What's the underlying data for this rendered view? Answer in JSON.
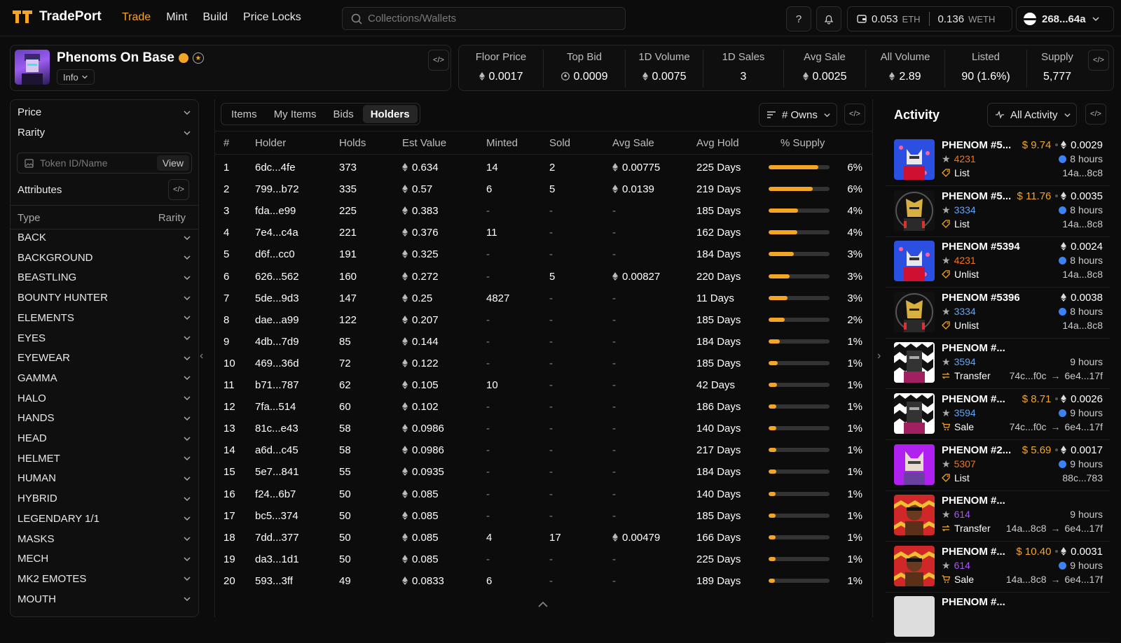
{
  "header": {
    "brand": "TradePort",
    "nav": [
      "Trade",
      "Mint",
      "Build",
      "Price Locks"
    ],
    "search_placeholder": "Collections/Wallets",
    "help": "?",
    "wallet_eth": "0.053",
    "wallet_eth_unit": "ETH",
    "wallet_weth": "0.136",
    "wallet_weth_unit": "WETH",
    "account": "268...64a"
  },
  "collection": {
    "name": "Phenoms On Base",
    "info_label": "Info"
  },
  "stats": [
    {
      "label": "Floor Price",
      "value": "0.0017",
      "eth": true
    },
    {
      "label": "Top Bid",
      "value": "0.0009",
      "eth": true
    },
    {
      "label": "1D Volume",
      "value": "0.0075",
      "eth": true
    },
    {
      "label": "1D Sales",
      "value": "3",
      "eth": false
    },
    {
      "label": "Avg Sale",
      "value": "0.0025",
      "eth": true
    },
    {
      "label": "All Volume",
      "value": "2.89",
      "eth": true
    },
    {
      "label": "Listed",
      "value": "90 (1.6%)",
      "eth": false
    },
    {
      "label": "Supply",
      "value": "5,777",
      "eth": false
    }
  ],
  "filters": {
    "price_label": "Price",
    "rarity_label": "Rarity",
    "token_placeholder": "Token ID/Name",
    "view_label": "View",
    "attributes_label": "Attributes",
    "type_header": "Type",
    "rarity_header": "Rarity",
    "attributes": [
      "BACK",
      "BACKGROUND",
      "BEASTLING",
      "BOUNTY HUNTER",
      "ELEMENTS",
      "EYES",
      "EYEWEAR",
      "GAMMA",
      "HALO",
      "HANDS",
      "HEAD",
      "HELMET",
      "HUMAN",
      "HYBRID",
      "LEGENDARY 1/1",
      "MASKS",
      "MECH",
      "MK2 EMOTES",
      "MOUTH"
    ]
  },
  "tabs": [
    "Items",
    "My Items",
    "Bids",
    "Holders"
  ],
  "sort_label": "# Owns",
  "table": {
    "headers": [
      "#",
      "Holder",
      "Holds",
      "Est Value",
      "Minted",
      "Sold",
      "Avg Sale",
      "Avg Hold",
      "% Supply"
    ],
    "rows": [
      {
        "n": "1",
        "holder": "6dc...4fe",
        "holds": "373",
        "est": "0.634",
        "minted": "14",
        "sold": "2",
        "avg": "0.00775",
        "hold": "225 Days",
        "pct": "6%",
        "fill": 0.065
      },
      {
        "n": "2",
        "holder": "799...b72",
        "holds": "335",
        "est": "0.57",
        "minted": "6",
        "sold": "5",
        "avg": "0.0139",
        "hold": "219 Days",
        "pct": "6%",
        "fill": 0.058
      },
      {
        "n": "3",
        "holder": "fda...e99",
        "holds": "225",
        "est": "0.383",
        "minted": "-",
        "sold": "-",
        "avg": "-",
        "hold": "185 Days",
        "pct": "4%",
        "fill": 0.039
      },
      {
        "n": "4",
        "holder": "7e4...c4a",
        "holds": "221",
        "est": "0.376",
        "minted": "11",
        "sold": "-",
        "avg": "-",
        "hold": "162 Days",
        "pct": "4%",
        "fill": 0.038
      },
      {
        "n": "5",
        "holder": "d6f...cc0",
        "holds": "191",
        "est": "0.325",
        "minted": "-",
        "sold": "-",
        "avg": "-",
        "hold": "184 Days",
        "pct": "3%",
        "fill": 0.033
      },
      {
        "n": "6",
        "holder": "626...562",
        "holds": "160",
        "est": "0.272",
        "minted": "-",
        "sold": "5",
        "avg": "0.00827",
        "hold": "220 Days",
        "pct": "3%",
        "fill": 0.028
      },
      {
        "n": "7",
        "holder": "5de...9d3",
        "holds": "147",
        "est": "0.25",
        "minted": "4827",
        "sold": "-",
        "avg": "-",
        "hold": "11 Days",
        "pct": "3%",
        "fill": 0.025
      },
      {
        "n": "8",
        "holder": "dae...a99",
        "holds": "122",
        "est": "0.207",
        "minted": "-",
        "sold": "-",
        "avg": "-",
        "hold": "185 Days",
        "pct": "2%",
        "fill": 0.021
      },
      {
        "n": "9",
        "holder": "4db...7d9",
        "holds": "85",
        "est": "0.144",
        "minted": "-",
        "sold": "-",
        "avg": "-",
        "hold": "184 Days",
        "pct": "1%",
        "fill": 0.015
      },
      {
        "n": "10",
        "holder": "469...36d",
        "holds": "72",
        "est": "0.122",
        "minted": "-",
        "sold": "-",
        "avg": "-",
        "hold": "185 Days",
        "pct": "1%",
        "fill": 0.012
      },
      {
        "n": "11",
        "holder": "b71...787",
        "holds": "62",
        "est": "0.105",
        "minted": "10",
        "sold": "-",
        "avg": "-",
        "hold": "42 Days",
        "pct": "1%",
        "fill": 0.011
      },
      {
        "n": "12",
        "holder": "7fa...514",
        "holds": "60",
        "est": "0.102",
        "minted": "-",
        "sold": "-",
        "avg": "-",
        "hold": "186 Days",
        "pct": "1%",
        "fill": 0.01
      },
      {
        "n": "13",
        "holder": "81c...e43",
        "holds": "58",
        "est": "0.0986",
        "minted": "-",
        "sold": "-",
        "avg": "-",
        "hold": "140 Days",
        "pct": "1%",
        "fill": 0.01
      },
      {
        "n": "14",
        "holder": "a6d...c45",
        "holds": "58",
        "est": "0.0986",
        "minted": "-",
        "sold": "-",
        "avg": "-",
        "hold": "217 Days",
        "pct": "1%",
        "fill": 0.01
      },
      {
        "n": "15",
        "holder": "5e7...841",
        "holds": "55",
        "est": "0.0935",
        "minted": "-",
        "sold": "-",
        "avg": "-",
        "hold": "184 Days",
        "pct": "1%",
        "fill": 0.01
      },
      {
        "n": "16",
        "holder": "f24...6b7",
        "holds": "50",
        "est": "0.085",
        "minted": "-",
        "sold": "-",
        "avg": "-",
        "hold": "140 Days",
        "pct": "1%",
        "fill": 0.009
      },
      {
        "n": "17",
        "holder": "bc5...374",
        "holds": "50",
        "est": "0.085",
        "minted": "-",
        "sold": "-",
        "avg": "-",
        "hold": "185 Days",
        "pct": "1%",
        "fill": 0.009
      },
      {
        "n": "18",
        "holder": "7dd...377",
        "holds": "50",
        "est": "0.085",
        "minted": "4",
        "sold": "17",
        "avg": "0.00479",
        "hold": "166 Days",
        "pct": "1%",
        "fill": 0.009
      },
      {
        "n": "19",
        "holder": "da3...1d1",
        "holds": "50",
        "est": "0.085",
        "minted": "-",
        "sold": "-",
        "avg": "-",
        "hold": "225 Days",
        "pct": "1%",
        "fill": 0.009
      },
      {
        "n": "20",
        "holder": "593...3ff",
        "holds": "49",
        "est": "0.0833",
        "minted": "6",
        "sold": "-",
        "avg": "-",
        "hold": "189 Days",
        "pct": "1%",
        "fill": 0.008
      }
    ]
  },
  "activity": {
    "title": "Activity",
    "filter_label": "All Activity",
    "items": [
      {
        "name": "PHENOM #5...",
        "usd": "$ 9.74",
        "eth": "0.0029",
        "rank": "4231",
        "rank_color": "#f97316",
        "time": "8 hours",
        "time_icon": true,
        "type": "List",
        "type_icon": "tag",
        "addr_from": "14a...8c8",
        "addr_to": "",
        "thumb": "wolf-blue"
      },
      {
        "name": "PHENOM #5...",
        "usd": "$ 11.76",
        "eth": "0.0035",
        "rank": "3334",
        "rank_color": "#60a5fa",
        "time": "8 hours",
        "time_icon": true,
        "type": "List",
        "type_icon": "tag",
        "addr_from": "14a...8c8",
        "addr_to": "",
        "thumb": "gold-helmet"
      },
      {
        "name": "PHENOM #5394",
        "usd": "",
        "eth": "0.0024",
        "rank": "4231",
        "rank_color": "#f97316",
        "time": "8 hours",
        "time_icon": true,
        "type": "Unlist",
        "type_icon": "tag",
        "addr_from": "14a...8c8",
        "addr_to": "",
        "thumb": "wolf-blue"
      },
      {
        "name": "PHENOM #5396",
        "usd": "",
        "eth": "0.0038",
        "rank": "3334",
        "rank_color": "#60a5fa",
        "time": "8 hours",
        "time_icon": true,
        "type": "Unlist",
        "type_icon": "tag",
        "addr_from": "14a...8c8",
        "addr_to": "",
        "thumb": "gold-helmet"
      },
      {
        "name": "PHENOM #...",
        "usd": "",
        "eth": "",
        "rank": "3594",
        "rank_color": "#60a5fa",
        "time": "9 hours",
        "time_icon": false,
        "type": "Transfer",
        "type_icon": "transfer",
        "addr_from": "74c...f0c",
        "addr_to": "6e4...17f",
        "thumb": "zigzag"
      },
      {
        "name": "PHENOM #...",
        "usd": "$ 8.71",
        "eth": "0.0026",
        "rank": "3594",
        "rank_color": "#60a5fa",
        "time": "9 hours",
        "time_icon": true,
        "type": "Sale",
        "type_icon": "cart",
        "addr_from": "74c...f0c",
        "addr_to": "6e4...17f",
        "thumb": "zigzag"
      },
      {
        "name": "PHENOM #2...",
        "usd": "$ 5.69",
        "eth": "0.0017",
        "rank": "5307",
        "rank_color": "#f97316",
        "time": "9 hours",
        "time_icon": true,
        "type": "List",
        "type_icon": "tag",
        "addr_from": "88c...783",
        "addr_to": "",
        "thumb": "fox-purple"
      },
      {
        "name": "PHENOM #...",
        "usd": "",
        "eth": "",
        "rank": "614",
        "rank_color": "#a855f7",
        "time": "9 hours",
        "time_icon": false,
        "type": "Transfer",
        "type_icon": "transfer",
        "addr_from": "14a...8c8",
        "addr_to": "6e4...17f",
        "thumb": "red-fire"
      },
      {
        "name": "PHENOM #...",
        "usd": "$ 10.40",
        "eth": "0.0031",
        "rank": "614",
        "rank_color": "#a855f7",
        "time": "9 hours",
        "time_icon": true,
        "type": "Sale",
        "type_icon": "cart",
        "addr_from": "14a...8c8",
        "addr_to": "6e4...17f",
        "thumb": "red-fire"
      },
      {
        "name": "PHENOM #...",
        "usd": "",
        "eth": "",
        "rank": "",
        "rank_color": "#60a5fa",
        "time": "",
        "time_icon": false,
        "type": "",
        "type_icon": "",
        "addr_from": "",
        "addr_to": "",
        "thumb": "grey"
      }
    ]
  },
  "colors": {
    "accent": "#f5a524",
    "background": "#0c0c0c",
    "border": "#262626"
  }
}
